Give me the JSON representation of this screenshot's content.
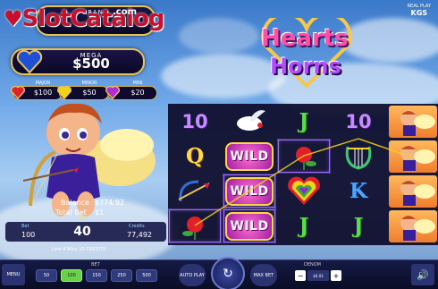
{
  "watermark": {
    "text": "SlotCatalog",
    "suffix": ".com"
  },
  "jackpots": {
    "grand": {
      "title": "GRAND",
      "value": ""
    },
    "mega": {
      "title": "MEGA",
      "value": "$500"
    },
    "major": {
      "title": "MAJOR",
      "value": "$100"
    },
    "minor": {
      "title": "MINOR",
      "value": "$50"
    },
    "mini": {
      "title": "MINI",
      "value": "$20"
    }
  },
  "logo": {
    "line1": "Hearts",
    "line2": "Horns"
  },
  "brand": {
    "small": "REAL PLAY",
    "name": "KGS"
  },
  "balance": {
    "balance_label": "Balance",
    "balance_value": "$774.92",
    "total_bet_label": "Total Bet",
    "total_bet_value": "$1"
  },
  "infobar": {
    "bet_label": "Bet",
    "bet_value": "100",
    "win_label": "WIN",
    "win_value": "40",
    "credits_label": "Credits",
    "credits_value": "77,492"
  },
  "lines_text": "Line 4 Wins 10 CREDITS",
  "reels": [
    [
      "10",
      "Q",
      "bow",
      "rose"
    ],
    [
      "dove",
      "WILD",
      "WILD",
      "WILD"
    ],
    [
      "J",
      "rose",
      "heart",
      "J"
    ],
    [
      "10",
      "lyre",
      "K",
      "J"
    ],
    [
      "cupid",
      "cupid",
      "cupid",
      "cupid"
    ]
  ],
  "bottom": {
    "menu": "MENU",
    "bet_label": "BET",
    "bet_options": [
      "50",
      "100",
      "150",
      "250",
      "500"
    ],
    "auto_play": "AUTO PLAY",
    "max_bet": "MAX BET",
    "denom_label": "DENOM",
    "denom_value": "$0.01",
    "minus": "−",
    "plus": "+"
  }
}
